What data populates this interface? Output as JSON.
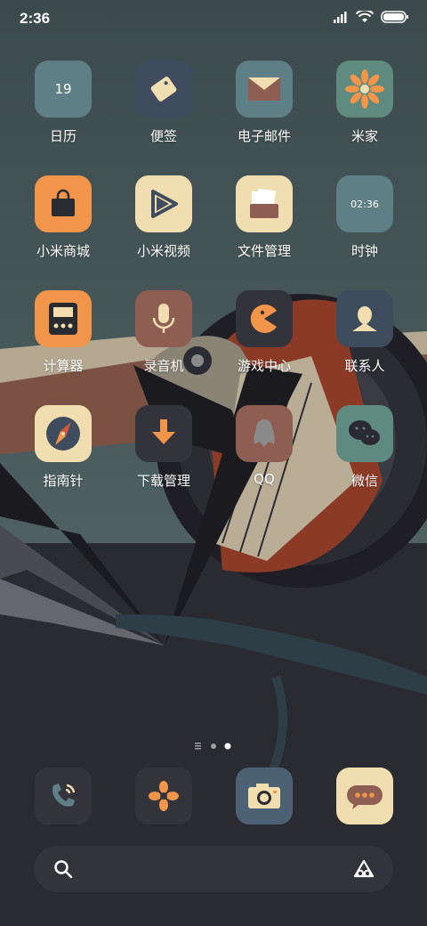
{
  "status_bar": {
    "time": "2:36"
  },
  "apps": [
    {
      "id": "calendar",
      "label": "日历",
      "color": "#5f7f86",
      "icon_text": "19"
    },
    {
      "id": "notes",
      "label": "便签",
      "color": "#3f4c5e"
    },
    {
      "id": "email",
      "label": "电子邮件",
      "color": "#5f7f86"
    },
    {
      "id": "mihome",
      "label": "米家",
      "color": "#5f8a80"
    },
    {
      "id": "mall",
      "label": "小米商城",
      "color": "#f0954a"
    },
    {
      "id": "video",
      "label": "小米视频",
      "color": "#f1deb0"
    },
    {
      "id": "files",
      "label": "文件管理",
      "color": "#f1deb0"
    },
    {
      "id": "clock",
      "label": "时钟",
      "color": "#5f7f86",
      "icon_text": "02:36"
    },
    {
      "id": "calculator",
      "label": "计算器",
      "color": "#f0954a"
    },
    {
      "id": "recorder",
      "label": "录音机",
      "color": "#8f5e52"
    },
    {
      "id": "gamecenter",
      "label": "游戏中心",
      "color": "#33333b"
    },
    {
      "id": "contacts",
      "label": "联系人",
      "color": "#3f4c5e"
    },
    {
      "id": "compass",
      "label": "指南针",
      "color": "#f1deb0"
    },
    {
      "id": "downloads",
      "label": "下载管理",
      "color": "#33333b"
    },
    {
      "id": "qq",
      "label": "QQ",
      "color": "#8f5e52"
    },
    {
      "id": "wechat",
      "label": "微信",
      "color": "#5f8a80"
    }
  ],
  "dock": [
    {
      "id": "phone",
      "color": "#33333b"
    },
    {
      "id": "browser",
      "color": "#33333b"
    },
    {
      "id": "camera",
      "color": "#4c6274"
    },
    {
      "id": "messages",
      "color": "#f1deb0"
    }
  ],
  "page_indicator": {
    "pages": 3,
    "active": 2
  }
}
